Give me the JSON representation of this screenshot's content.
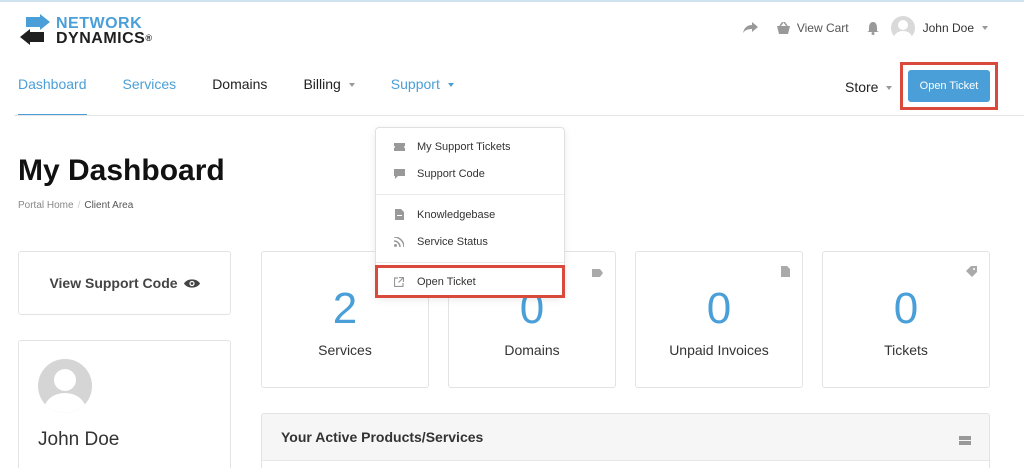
{
  "brand": {
    "line1": "NETWORK",
    "line2": "DYNAMICS",
    "mark": "®",
    "logo_icon": "double-arrow-logo",
    "colors": {
      "blue": "#4a9fd8",
      "dark": "#1f1f1f"
    }
  },
  "header": {
    "share_icon": "share-arrow-icon",
    "cart_icon": "basket-icon",
    "cart_label": "View Cart",
    "bell_icon": "bell-icon",
    "user_name": "John Doe"
  },
  "nav": {
    "items": [
      {
        "label": "Dashboard",
        "active": true
      },
      {
        "label": "Services"
      },
      {
        "label": "Domains"
      },
      {
        "label": "Billing",
        "has_caret": true
      },
      {
        "label": "Support",
        "has_caret": true,
        "open": true
      }
    ],
    "store_label": "Store",
    "open_ticket_button": "Open Ticket"
  },
  "support_menu": {
    "items": [
      {
        "label": "My Support Tickets",
        "icon": "ticket-icon"
      },
      {
        "label": "Support Code",
        "icon": "comment-icon"
      },
      {
        "label": "Knowledgebase",
        "icon": "document-icon"
      },
      {
        "label": "Service Status",
        "icon": "rss-icon"
      },
      {
        "label": "Open Ticket",
        "icon": "external-link-icon"
      }
    ]
  },
  "page": {
    "title": "My Dashboard",
    "breadcrumb": {
      "home": "Portal Home",
      "separator": "/",
      "current": "Client Area"
    }
  },
  "sidebar": {
    "support_code_label": "View Support Code",
    "eye_icon": "eye-icon",
    "profile_name": "John Doe"
  },
  "stats": [
    {
      "value": "2",
      "label": "Services",
      "icon": "cube-icon"
    },
    {
      "value": "0",
      "label": "Domains",
      "icon": "label-icon"
    },
    {
      "value": "0",
      "label": "Unpaid Invoices",
      "icon": "invoice-icon"
    },
    {
      "value": "0",
      "label": "Tickets",
      "icon": "tag-icon"
    }
  ],
  "products_panel": {
    "title": "Your Active Products/Services",
    "icon": "server-icon"
  },
  "highlight_color": "#d94a3c"
}
